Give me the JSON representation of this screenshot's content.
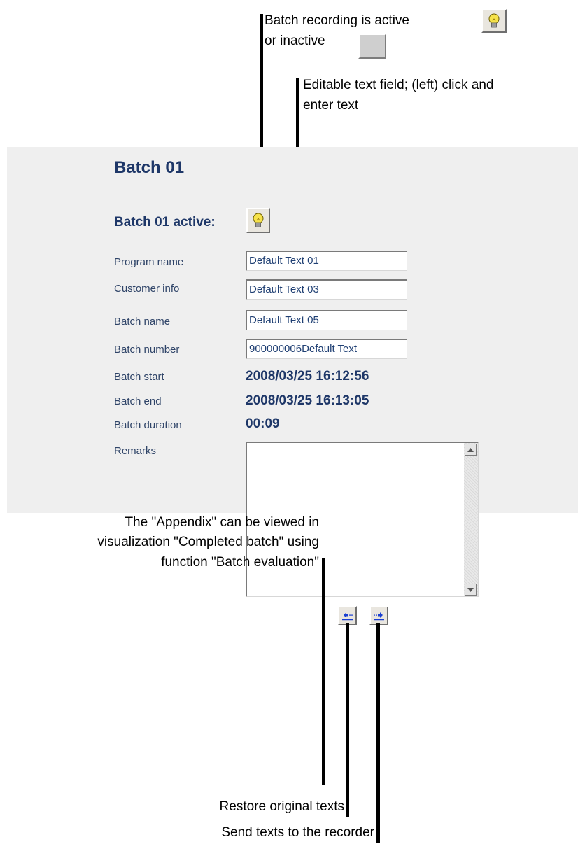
{
  "annotations": {
    "batch_recording_line1": "Batch recording is active",
    "batch_recording_line2": "or inactive",
    "editable_line1": "Editable text field; (left) click and",
    "editable_line2": "enter text",
    "appendix_line1": "The \"Appendix\" can be viewed in",
    "appendix_line2": "visualization \"Completed batch\" using",
    "appendix_line3": "function \"Batch evaluation\"",
    "restore": "Restore original texts",
    "send": "Send texts to the recorder"
  },
  "panel": {
    "title": "Batch 01",
    "active_label": "Batch 01 active:",
    "fields": {
      "program_name": {
        "label": "Program name",
        "value": "Default Text 01"
      },
      "customer_info": {
        "label": "Customer info",
        "value": "Default Text 03"
      },
      "batch_name": {
        "label": "Batch name",
        "value": "Default Text 05"
      },
      "batch_number": {
        "label": "Batch number",
        "value": "900000006Default Text"
      }
    },
    "readouts": {
      "batch_start": {
        "label": "Batch start",
        "value": "2008/03/25 16:12:56"
      },
      "batch_end": {
        "label": "Batch end",
        "value": "2008/03/25 16:13:05"
      },
      "batch_duration": {
        "label": "Batch duration",
        "value": "00:09"
      }
    },
    "remarks": {
      "label": "Remarks",
      "value": ""
    }
  },
  "colors": {
    "panel_bg": "#efefef",
    "title_blue": "#1e3768",
    "label_blue": "#2f4468",
    "bulb_yellow": "#f6e24a",
    "arrow_blue": "#1a3fd1"
  },
  "icons": [
    "light-bulb-icon",
    "restore-arrow-icon",
    "send-arrow-icon",
    "scroll-up-icon",
    "scroll-down-icon"
  ]
}
